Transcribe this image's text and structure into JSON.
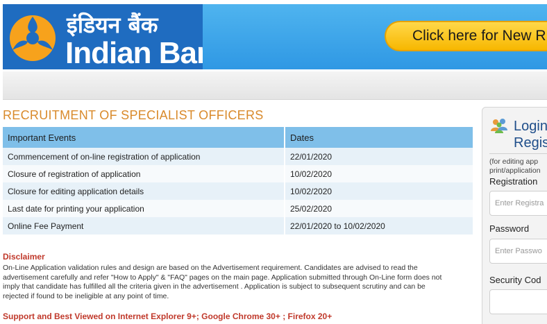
{
  "header": {
    "brand_hindi": "इंडियन बैंक",
    "brand_english": "Indian Bank",
    "new_button_label": "Click here for New R"
  },
  "colors": {
    "brand_blue": "#1f6cc0",
    "banner_blue": "#3ba4e9",
    "button_yellow": "#f7c21c",
    "title_orange": "#d98a2b",
    "table_header_blue": "#7fbfe9",
    "disclaimer_red": "#c0392b"
  },
  "main": {
    "title": "RECRUITMENT OF SPECIALIST OFFICERS",
    "table": {
      "headers": [
        "Important Events",
        "Dates"
      ],
      "rows": [
        [
          "Commencement of on-line registration of application",
          "22/01/2020"
        ],
        [
          "Closure of registration of application",
          "10/02/2020"
        ],
        [
          "Closure for editing application details",
          "10/02/2020"
        ],
        [
          "Last date for printing your application",
          "25/02/2020"
        ],
        [
          "Online Fee Payment",
          "22/01/2020 to 10/02/2020"
        ]
      ]
    },
    "disclaimer_title": "Disclaimer",
    "disclaimer_lines": [
      "On-Line Application validation rules and design are based on the Advertisement requirement. Candidates are advised to read the",
      "advertisement carefully and refer \"How to Apply\" & \"FAQ\" pages on the main page. Application submitted through On-Line form does not",
      "imply that candidate has fulfilled all the criteria given in the advertisement . Application is subject to subsequent scrutiny and can be",
      "rejected if found to be ineligible at any point of time."
    ],
    "support_note": "Support and Best Viewed on Internet Explorer 9+; Google Chrome 30+ ; Firefox 20+"
  },
  "login": {
    "title_line1": "Login",
    "title_line2": "Regis",
    "note_line1": "(for editing app",
    "note_line2": "print/application",
    "registration_label": "Registration",
    "registration_placeholder": "Enter Registra",
    "password_label": "Password",
    "password_placeholder": "Enter Passwo",
    "security_label": "Security Cod",
    "login_icon": "users-icon"
  }
}
